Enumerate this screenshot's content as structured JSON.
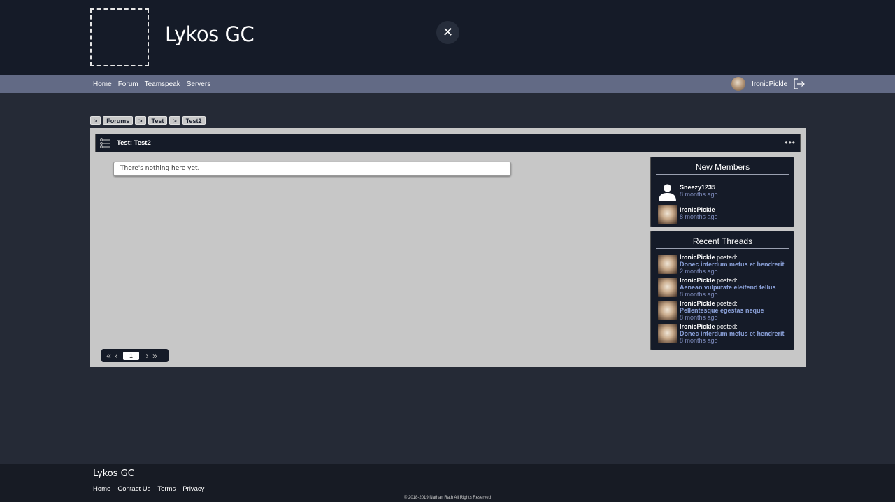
{
  "header": {
    "title": "Lykos GC",
    "close_label": "✕"
  },
  "nav": {
    "links": [
      "Home",
      "Forum",
      "Teamspeak",
      "Servers"
    ],
    "username": "IronicPickle"
  },
  "breadcrumb": [
    ">",
    "Forums",
    ">",
    "Test",
    ">",
    "Test2"
  ],
  "panel": {
    "title": "Test: Test2",
    "menu_label": "•••",
    "empty_message": "There's nothing here yet."
  },
  "pagination": {
    "first": "«",
    "prev": "‹",
    "page": "1",
    "next": "›",
    "last": "»"
  },
  "new_members": {
    "title": "New Members",
    "items": [
      {
        "name": "Sneezy1235",
        "time": "8 months ago"
      },
      {
        "name": "IronicPickle",
        "time": "8 months ago"
      }
    ]
  },
  "recent_threads": {
    "title": "Recent Threads",
    "posted_word": "posted:",
    "items": [
      {
        "user": "IronicPickle",
        "thread": "Donec interdum metus et hendrerit",
        "time": "2 months ago"
      },
      {
        "user": "IronicPickle",
        "thread": "Aenean vulputate eleifend tellus",
        "time": "8 months ago"
      },
      {
        "user": "IronicPickle",
        "thread": "Pellentesque egestas neque",
        "time": "8 months ago"
      },
      {
        "user": "IronicPickle",
        "thread": "Donec interdum metus et hendrerit",
        "time": "8 months ago"
      }
    ]
  },
  "footer": {
    "title": "Lykos GC",
    "links": [
      "Home",
      "Contact Us",
      "Terms",
      "Privacy"
    ],
    "copyright": "© 2018-2019 Nathan Rath All Rights Reserved"
  },
  "icons": {
    "close": "close-icon",
    "logout": "logout-icon",
    "list": "list-icon",
    "more": "more-dots-icon",
    "default_avatar": "person-silhouette-icon"
  }
}
